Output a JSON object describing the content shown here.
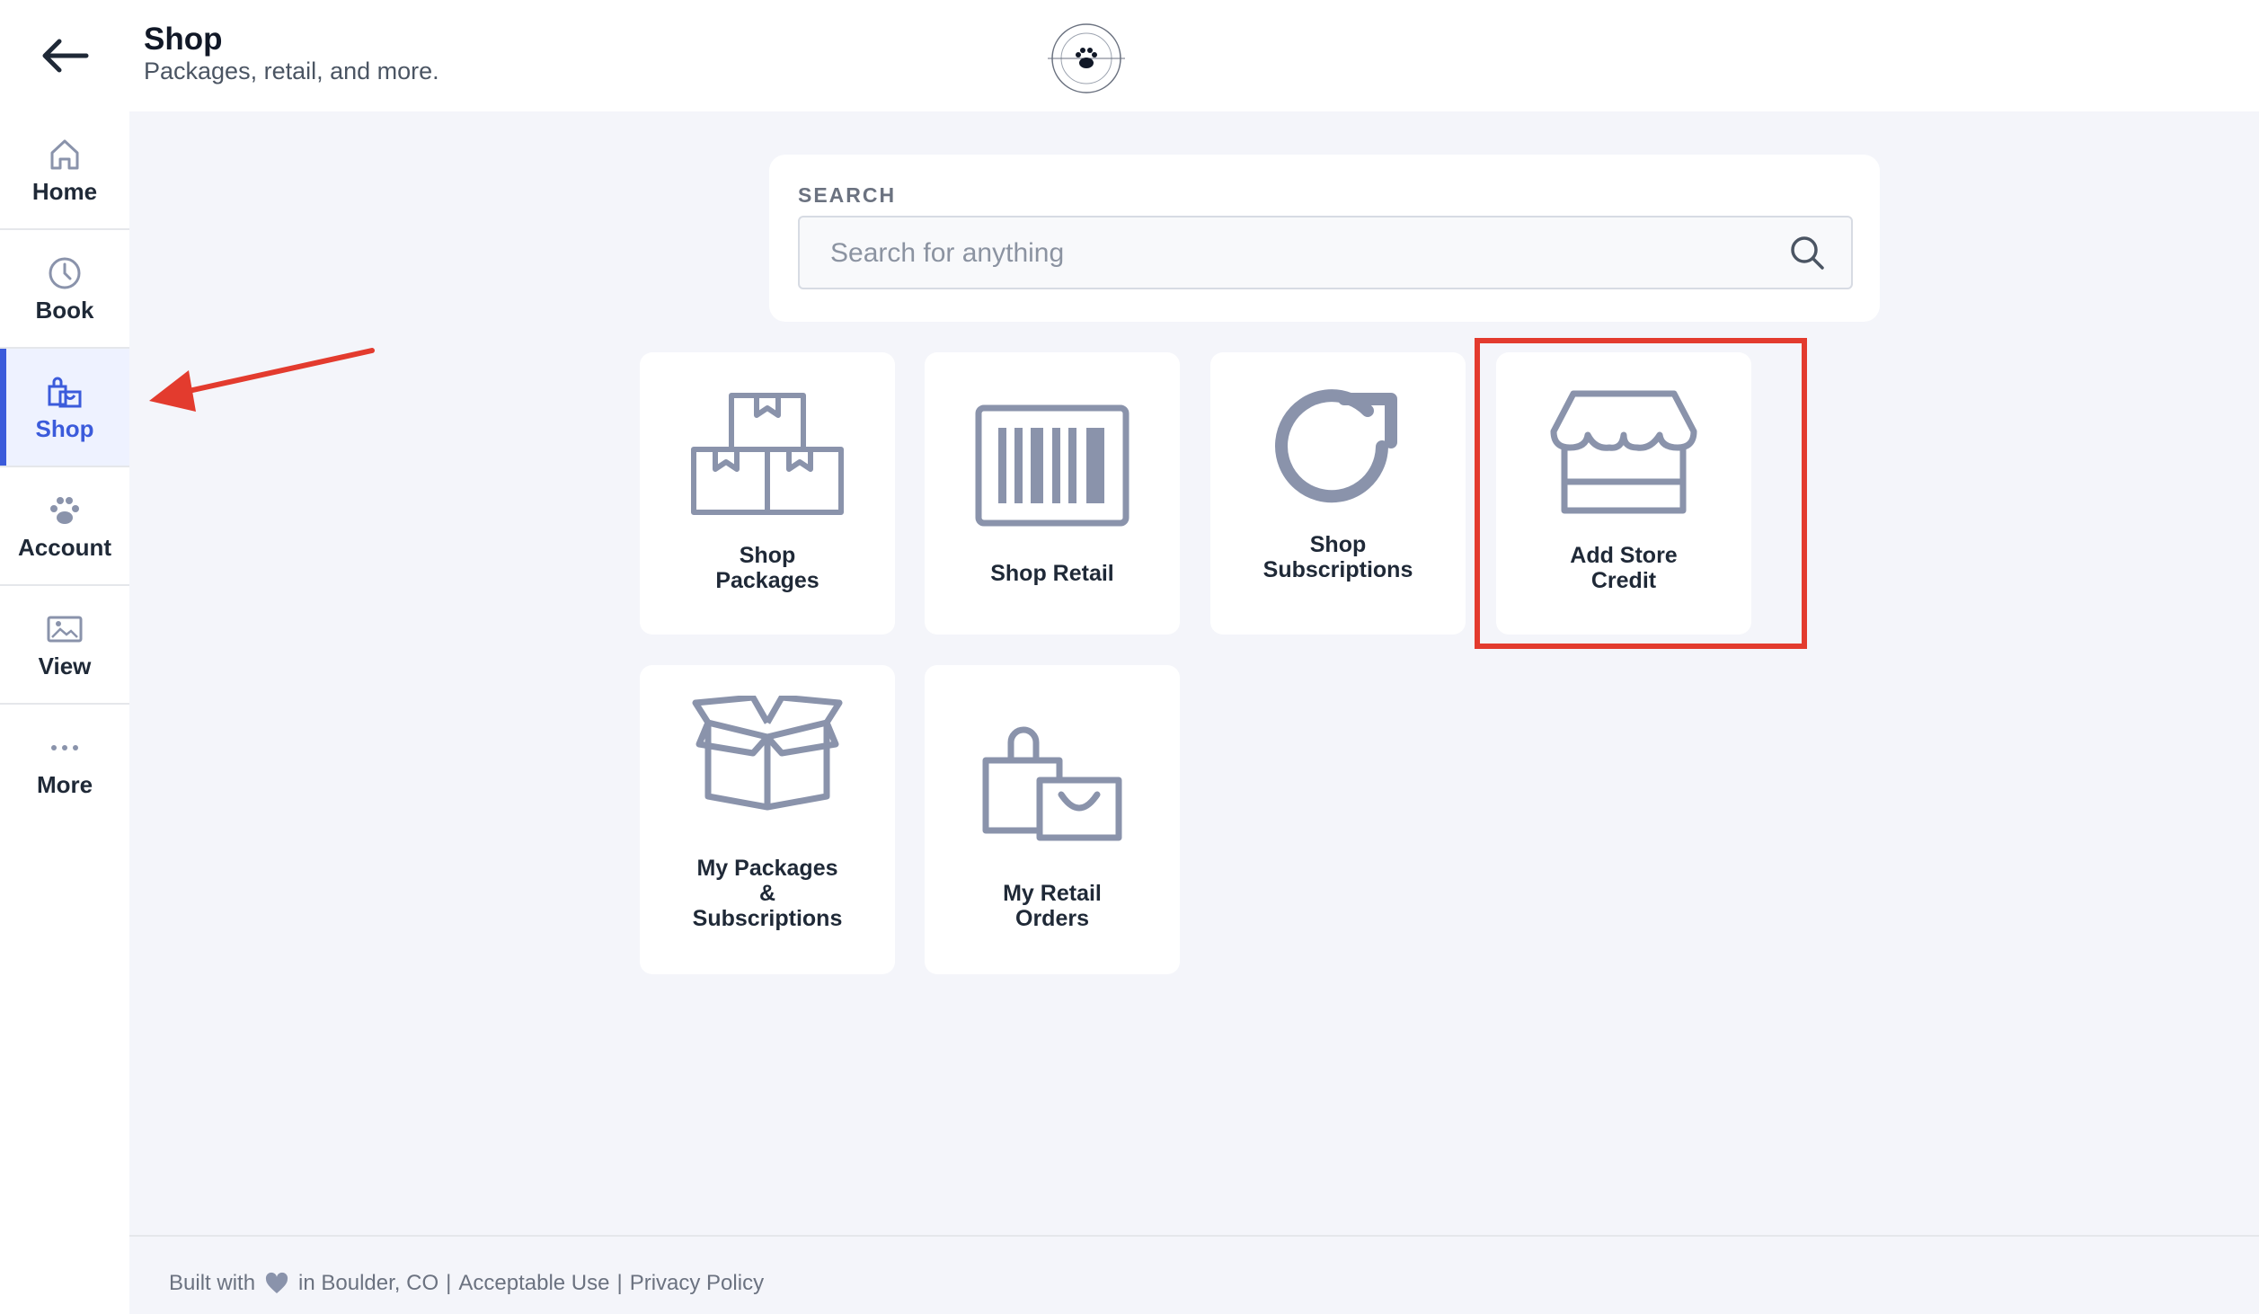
{
  "header": {
    "title": "Shop",
    "subtitle": "Packages, retail, and more."
  },
  "sidebar": {
    "items": [
      {
        "label": "Home",
        "icon": "home-icon"
      },
      {
        "label": "Book",
        "icon": "clock-icon"
      },
      {
        "label": "Shop",
        "icon": "shopping-bags-icon",
        "active": true
      },
      {
        "label": "Account",
        "icon": "paw-icon"
      },
      {
        "label": "View",
        "icon": "gallery-icon"
      },
      {
        "label": "More",
        "icon": "ellipsis-icon"
      }
    ]
  },
  "search": {
    "label": "SEARCH",
    "placeholder": "Search for anything"
  },
  "tiles": [
    {
      "label": "Shop\nPackages",
      "icon": "packages-icon"
    },
    {
      "label": "Shop Retail",
      "icon": "barcode-icon"
    },
    {
      "label": "Shop\nSubscriptions",
      "icon": "refresh-icon"
    },
    {
      "label": "Add Store\nCredit",
      "icon": "storefront-icon"
    },
    {
      "label": "My Packages\n&\nSubscriptions",
      "icon": "open-box-icon"
    },
    {
      "label": "My Retail\nOrders",
      "icon": "shopping-bags-icon"
    }
  ],
  "footer": {
    "built_with": "Built with",
    "location": "in Boulder, CO",
    "separator": "|",
    "acceptable_use": "Acceptable Use",
    "privacy_policy": "Privacy Policy"
  },
  "colors": {
    "accent": "#3b5bdb",
    "icon_gray": "#8a93ab",
    "annotation_red": "#e33b2e",
    "background": "#f4f5fa"
  }
}
